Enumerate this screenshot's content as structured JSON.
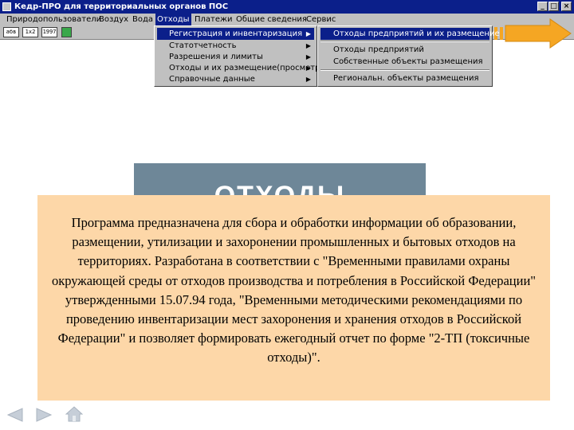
{
  "window": {
    "title": "Кедр-ПРО для территориальных органов ПОС",
    "min_label": "_",
    "max_label": "□",
    "close_label": "×"
  },
  "menubar": [
    {
      "label": "Природопользователи"
    },
    {
      "label": "Воздух"
    },
    {
      "label": "Вода"
    },
    {
      "label": "Отходы"
    },
    {
      "label": "Платежи"
    },
    {
      "label": "Общие сведения"
    },
    {
      "label": "Сервис"
    }
  ],
  "toolbar": [
    "абв",
    "1x2",
    "1997",
    ""
  ],
  "menu_otkhody": [
    {
      "label": "Регистрация и инвентаризация"
    },
    {
      "label": "Статотчетность"
    },
    {
      "label": "Разрешения и лимиты"
    },
    {
      "label": "Отходы и их размещение(просмотр)"
    },
    {
      "label": "Справочные данные"
    }
  ],
  "submenu": [
    {
      "label": "Отходы предприятий и их размещение"
    },
    {
      "label": "Отходы предприятий"
    },
    {
      "label": "Собственные объекты размещения"
    },
    {
      "label": "Региональн. объекты размещения"
    }
  ],
  "slate": {
    "title": "ОТХОДЫ"
  },
  "info_text": "Программа предназначена для сбора и обработки информации об образовании, размещении, утилизации и захоронении промышленных и бытовых отходов на территориях. Разработана в соответствии с \"Временными правилами охраны окружающей среды от отходов производства и потребления в Российской Федерации\" утвержденными 15.07.94 года, \"Временными методическими рекомендациями по проведению инвентаризации мест захоронения и хранения отходов в Российской Федерации\" и позволяет формировать ежегодный отчет по форме \"2-ТП (токсичные отходы)\".",
  "colors": {
    "title_bar": "#0b1f8a",
    "chrome": "#c0c0c0",
    "slate": "#6e8798",
    "info_box": "#fdd7a8",
    "big_arrow": "#f5a623"
  },
  "icons": [
    "app-icon",
    "arrow-right-icon",
    "nav-back-icon",
    "nav-forward-icon",
    "nav-home-icon"
  ]
}
